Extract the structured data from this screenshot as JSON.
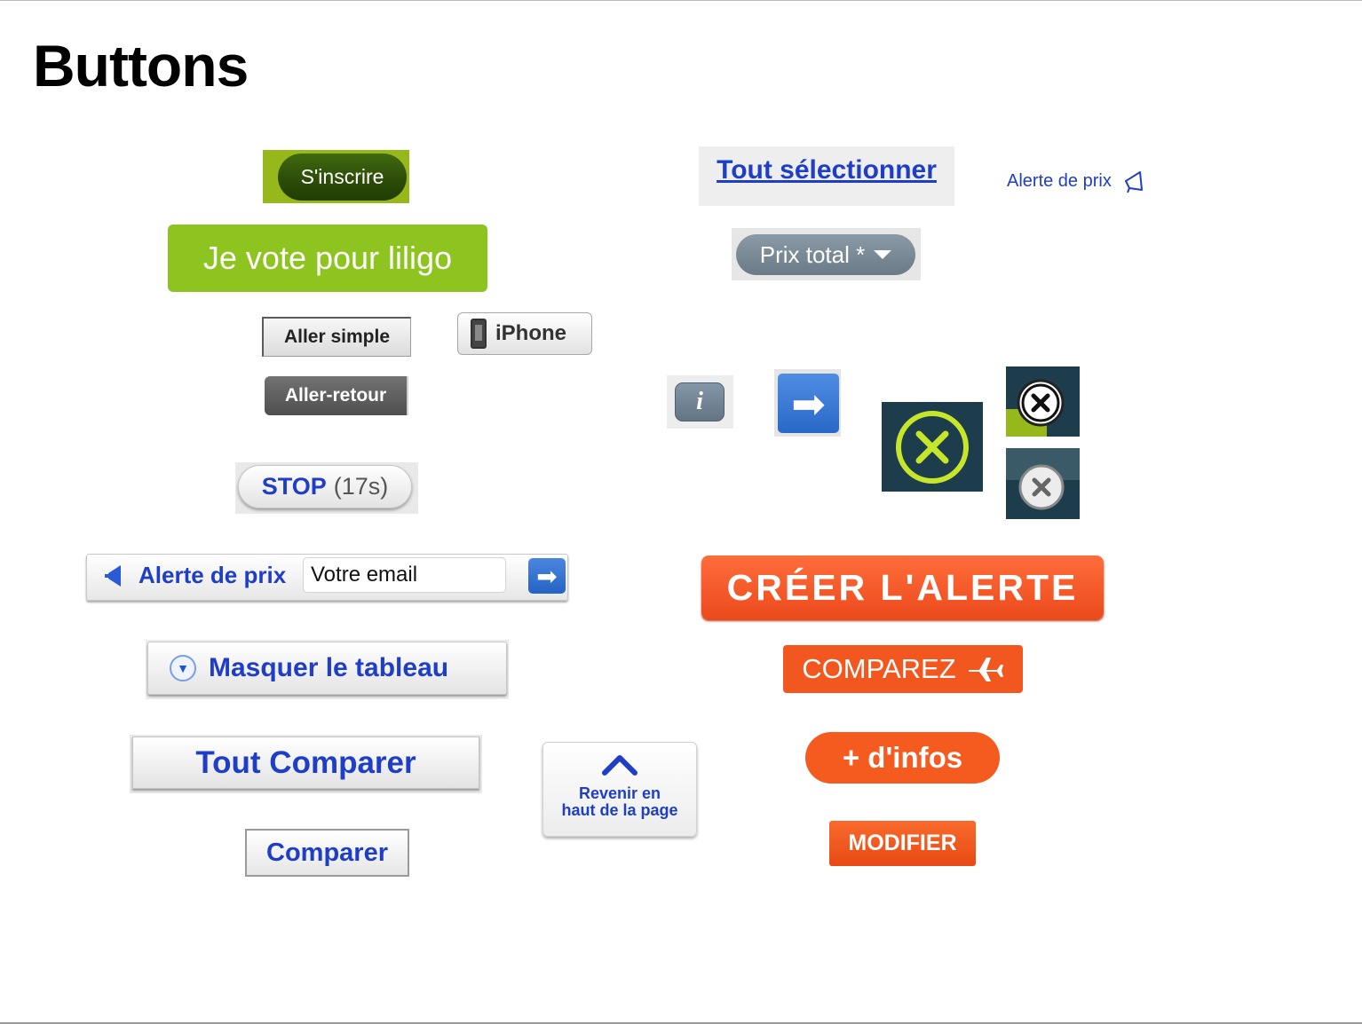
{
  "page": {
    "title": "Buttons"
  },
  "buttons": {
    "sinscrire": "S'inscrire",
    "vote": "Je vote pour liligo",
    "aller_simple": "Aller simple",
    "aller_retour": "Aller-retour",
    "iphone": "iPhone",
    "stop_label": "STOP",
    "stop_count": "(17s)",
    "masquer": "Masquer le tableau",
    "tout_comparer": "Tout Comparer",
    "comparer": "Comparer",
    "revenir_line1": "Revenir en",
    "revenir_line2": "haut de la page",
    "tout_selectionner": "Tout sélectionner",
    "alerte_de_prix_link": "Alerte de prix",
    "prix_total": "Prix total *",
    "info_glyph": "i",
    "creer_alerte": "CRÉER L'ALERTE",
    "comparez": "COMPAREZ",
    "plus_infos": "+ d'infos",
    "modifier": "MODIFIER"
  },
  "alert_bar": {
    "label": "Alerte de prix",
    "email_value": "Votre email"
  },
  "icons": {
    "bell": "bell-icon",
    "arrow": "arrow-right-icon",
    "close": "close-icon",
    "plane": "plane-icon",
    "phone": "phone-icon",
    "chevron_up": "chevron-up-icon",
    "chevron_down": "chevron-down-icon"
  },
  "colors": {
    "link_blue": "#1f3ec7",
    "orange": "#f2571f",
    "lime": "#8ec41f",
    "dark_teal": "#1d3d4d"
  }
}
